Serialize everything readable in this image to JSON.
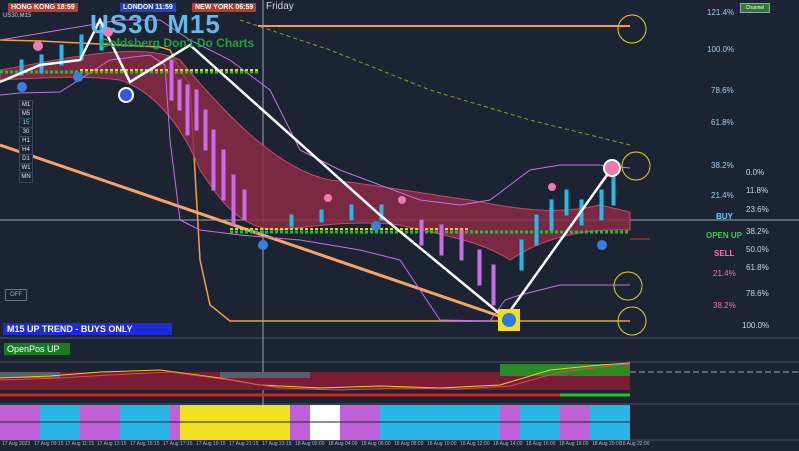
{
  "symbol_label": "US30,M15",
  "clocks": [
    {
      "label": "HONG KONG",
      "time": "18:59",
      "color": "#c0392b"
    },
    {
      "label": "LONDON",
      "time": "11:59",
      "color": "#1f3fd4"
    },
    {
      "label": "NEW YORK",
      "time": "06:59",
      "color": "#c0392b"
    }
  ],
  "day": "Friday",
  "title": "US30 M15",
  "subtitle": "Goldsberg Don't Do Charts",
  "timeframes": [
    "M1",
    "M5",
    "15",
    "30",
    "H1",
    "H4",
    "D1",
    "W1",
    "MN"
  ],
  "off_button": "OFF",
  "trend_banner": "M15  UP TREND - BUYS ONLY",
  "openpos": "OpenPos UP",
  "fib_right": [
    "121.4%",
    "100.0%",
    "78.6%",
    "61.8%",
    "38.2%",
    "21.4%"
  ],
  "fib_lower": [
    "0.0%",
    "11.8%",
    "23.6%",
    "38.2%",
    "50.0%",
    "61.8%",
    "21.4%",
    "78.6%",
    "38.2%",
    "100.0%"
  ],
  "buy": "BUY",
  "open_up": "OPEN UP",
  "sell": "SELL",
  "top_right_button": "Channel",
  "time_axis": [
    "17 Aug 2023",
    "17 Aug 09:15",
    "17 Aug 11:15",
    "17 Aug 13:15",
    "17 Aug 15:15",
    "17 Aug 17:15",
    "17 Aug 19:15",
    "17 Aug 21:15",
    "17 Aug 23:15",
    "18 Aug 02:00",
    "18 Aug 04:00",
    "18 Aug 06:00",
    "18 Aug 08:00",
    "18 Aug 10:00",
    "18 Aug 12:00",
    "18 Aug 14:00",
    "18 Aug 16:00",
    "18 Aug 18:00",
    "18 Aug 20:00",
    "18 Aug 22:00"
  ],
  "colors": {
    "background": "#1c2333",
    "ribbon": "#8a2a45",
    "orange": "#f0a040",
    "green": "#22c22a",
    "yellow": "#e6d21a",
    "purple": "#c96de8",
    "cyan": "#2ab7e8"
  }
}
